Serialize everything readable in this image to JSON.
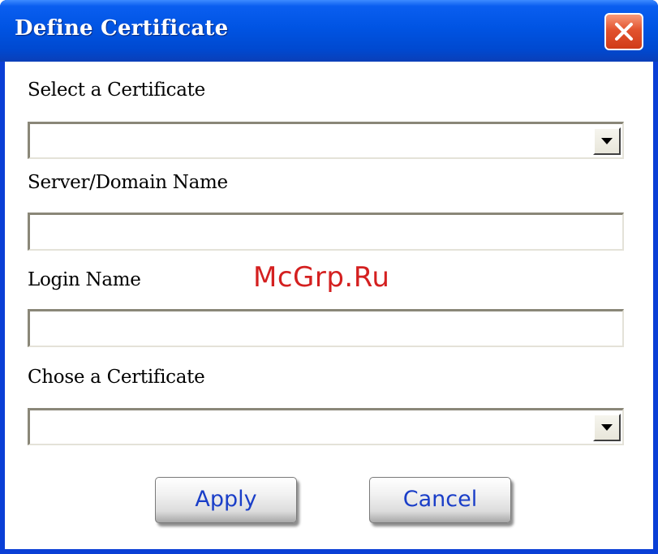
{
  "window": {
    "title": "Define Certificate"
  },
  "form": {
    "select_certificate": {
      "label": "Select a Certificate",
      "value": ""
    },
    "server_domain": {
      "label": "Server/Domain Name",
      "value": ""
    },
    "login_name": {
      "label": "Login Name",
      "value": ""
    },
    "chose_certificate": {
      "label": "Chose a Certificate",
      "value": ""
    }
  },
  "buttons": {
    "apply": "Apply",
    "cancel": "Cancel"
  },
  "watermark": "McGrp.Ru",
  "colors": {
    "titlebar": "#0054e3",
    "close_button": "#e2532e",
    "button_text": "#1a3ec8",
    "watermark": "#d42020"
  },
  "icons": {
    "close": "close-icon",
    "dropdown": "chevron-down-icon"
  }
}
